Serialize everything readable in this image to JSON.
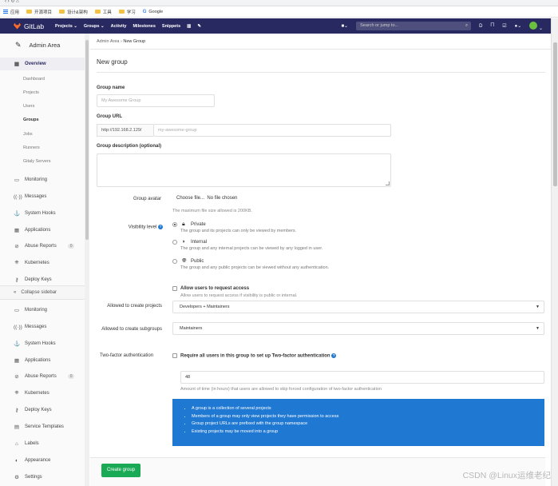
{
  "browser": {
    "bookmarks": [
      {
        "label": "应用",
        "icon": "apps-icon"
      },
      {
        "label": "开源项目",
        "icon": "folder-icon"
      },
      {
        "label": "设计&架构",
        "icon": "folder-icon"
      },
      {
        "label": "工具",
        "icon": "folder-icon"
      },
      {
        "label": "学习",
        "icon": "folder-icon"
      },
      {
        "label": "Google",
        "icon": "google-icon"
      }
    ]
  },
  "navbar": {
    "brand": "GitLab",
    "links": [
      "Projects ⌄",
      "Groups ⌄",
      "Activity",
      "Milestones",
      "Snippets"
    ],
    "search_placeholder": "Search or jump to...",
    "right_icons": [
      "plus-icon",
      "issues-icon",
      "merge-request-icon",
      "todo-icon",
      "help-icon",
      "avatar"
    ]
  },
  "sidebar": {
    "header": "Admin Area",
    "overview": "Overview",
    "overview_items": [
      "Dashboard",
      "Projects",
      "Users",
      "Groups",
      "Jobs",
      "Runners",
      "Gitaly Servers"
    ],
    "active_sub": "Groups",
    "items_top": [
      {
        "label": "Monitoring",
        "icon": "monitor-icon"
      },
      {
        "label": "Messages",
        "icon": "broadcast-icon"
      },
      {
        "label": "System Hooks",
        "icon": "hook-icon"
      },
      {
        "label": "Applications",
        "icon": "grid-icon"
      },
      {
        "label": "Abuse Reports",
        "icon": "abuse-icon",
        "badge": "0"
      },
      {
        "label": "Kubernetes",
        "icon": "kubernetes-icon"
      },
      {
        "label": "Deploy Keys",
        "icon": "key-icon"
      }
    ],
    "collapse_label": "Collapse sidebar",
    "items_bottom": [
      {
        "label": "Monitoring",
        "icon": "monitor-icon"
      },
      {
        "label": "Messages",
        "icon": "broadcast-icon"
      },
      {
        "label": "System Hooks",
        "icon": "hook-icon"
      },
      {
        "label": "Applications",
        "icon": "grid-icon"
      },
      {
        "label": "Abuse Reports",
        "icon": "abuse-icon",
        "badge": "0"
      },
      {
        "label": "Kubernetes",
        "icon": "kubernetes-icon"
      },
      {
        "label": "Deploy Keys",
        "icon": "key-icon"
      },
      {
        "label": "Service Templates",
        "icon": "template-icon"
      },
      {
        "label": "Labels",
        "icon": "label-icon"
      },
      {
        "label": "Appearance",
        "icon": "appearance-icon"
      },
      {
        "label": "Settings",
        "icon": "settings-icon"
      }
    ]
  },
  "breadcrumb": {
    "parent": "Admin Area",
    "sep": "›",
    "current": "New Group"
  },
  "form": {
    "title": "New group",
    "group_name_label": "Group name",
    "group_name_placeholder": "My Awesome Group",
    "group_url_label": "Group URL",
    "group_url_prefix": "http://192.168.2.129/",
    "group_url_placeholder": "my-awesome-group",
    "description_label": "Group description (optional)",
    "avatar_label": "Group avatar",
    "choose_file": "Choose file...",
    "no_file": "No file chosen",
    "avatar_help": "The maximum file size allowed is 200KB.",
    "visibility_label": "Visibility level",
    "visibility_options": [
      {
        "title": "Private",
        "desc": "The group and its projects can only be viewed by members.",
        "icon": "lock-icon",
        "selected": true
      },
      {
        "title": "Internal",
        "desc": "The group and any internal projects can be viewed by any logged in user.",
        "icon": "shield-icon",
        "selected": false
      },
      {
        "title": "Public",
        "desc": "The group and any public projects can be viewed without any authentication.",
        "icon": "globe-icon",
        "selected": false
      }
    ],
    "request_access_label": "Allow users to request access",
    "request_access_help": "Allow users to request access if visibility is public or internal.",
    "create_projects_label": "Allowed to create projects",
    "create_projects_value": "Developers + Maintainers",
    "create_subgroups_label": "Allowed to create subgroups",
    "create_subgroups_value": "Maintainers",
    "two_factor_label": "Two-factor authentication",
    "two_factor_check": "Require all users in this group to set up Two-factor authentication",
    "grace_value": "48",
    "grace_help": "Amount of time (in hours) that users are allowed to skip forced configuration of two-factor authentication",
    "info_items": [
      "A group is a collection of several projects",
      "Members of a group may only view projects they have permission to access",
      "Group project URLs are prefixed with the group namespace",
      "Existing projects may be moved into a group"
    ],
    "submit": "Create group"
  },
  "watermark": "CSDN @Linux运维老纪",
  "colors": {
    "navbar": "#292961",
    "brand": "#fc6d26",
    "primary": "#1f78d1",
    "success": "#1aaa55"
  }
}
